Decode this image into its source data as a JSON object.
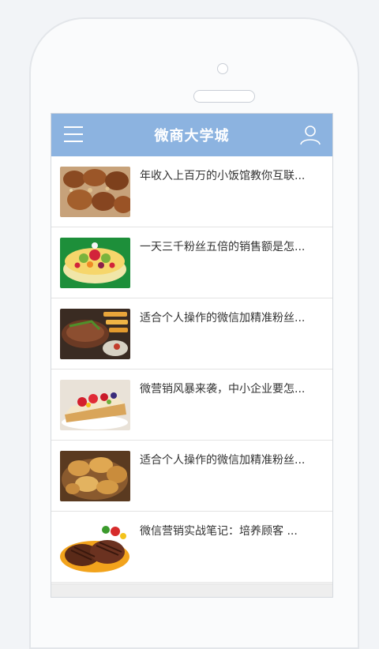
{
  "header": {
    "title": "微商大学城",
    "menu_icon": "hamburger-menu-icon",
    "user_icon": "user-profile-icon"
  },
  "articles": [
    {
      "title": "年收入上百万的小饭馆教你互联...",
      "image": "fried-chicken-dish"
    },
    {
      "title": "一天三千粉丝五倍的销售额是怎...",
      "image": "fruit-cake"
    },
    {
      "title": "适合个人操作的微信加精准粉丝...",
      "image": "steak-and-fries"
    },
    {
      "title": "微营销风暴来袭，中小企业要怎...",
      "image": "strawberry-tart"
    },
    {
      "title": "适合个人操作的微信加精准粉丝...",
      "image": "baked-pears"
    },
    {
      "title": "微信营销实战笔记：培养顾客 ...",
      "image": "grilled-steak-plate"
    }
  ],
  "colors": {
    "header_bg": "#8cb3e0",
    "header_text": "#ffffff",
    "item_text": "#333333"
  }
}
